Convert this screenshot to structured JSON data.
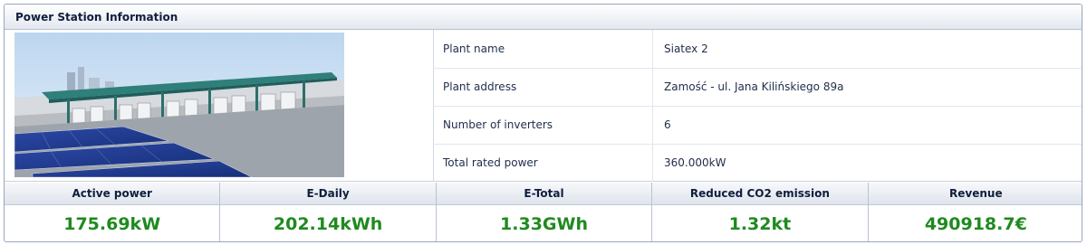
{
  "panel": {
    "title": "Power Station Information"
  },
  "info": [
    {
      "label": "Plant name",
      "value": "Siatex 2"
    },
    {
      "label": "Plant address",
      "value": "Zamość - ul. Jana Kilińskiego 89a"
    },
    {
      "label": "Number of inverters",
      "value": "6"
    },
    {
      "label": "Total rated power",
      "value": "360.000kW"
    }
  ],
  "stats": [
    {
      "label": "Active power",
      "value": "175.69kW"
    },
    {
      "label": "E-Daily",
      "value": "202.14kWh"
    },
    {
      "label": "E-Total",
      "value": "1.33GWh"
    },
    {
      "label": "Reduced CO2 emission",
      "value": "1.32kt"
    },
    {
      "label": "Revenue",
      "value": "490918.7€"
    }
  ],
  "colors": {
    "value_green": "#1f8a1f",
    "header_text": "#0f1e3d"
  }
}
